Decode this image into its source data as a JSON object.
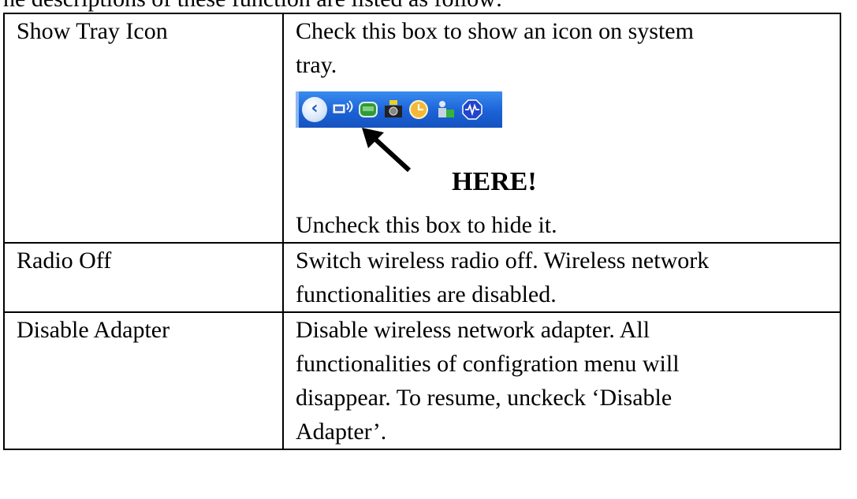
{
  "intro_text": "he descriptions of these function are listed as follow:",
  "rows": [
    {
      "name": "Show Tray Icon",
      "desc_lines": [
        "Check this box to show an icon on system",
        "tray."
      ],
      "callout": "HERE!",
      "desc_after": "Uncheck this box to hide it."
    },
    {
      "name": "Radio Off",
      "desc_lines": [
        "Switch wireless radio off. Wireless network",
        "functionalities are disabled."
      ]
    },
    {
      "name": "Disable Adapter",
      "desc_lines": [
        "Disable wireless network adapter. All",
        "functionalities of configration menu will",
        "disappear. To resume, unckeck ‘Disable",
        "Adapter’."
      ]
    }
  ],
  "tray_icons": [
    "taskbar-chevron-icon",
    "network-connection-icon",
    "wireless-utility-icon",
    "camera-icon",
    "clock-icon",
    "user-status-icon",
    "audio-wave-icon"
  ],
  "colors": {
    "taskbar_blue": "#1b62d6",
    "text": "#000000"
  }
}
